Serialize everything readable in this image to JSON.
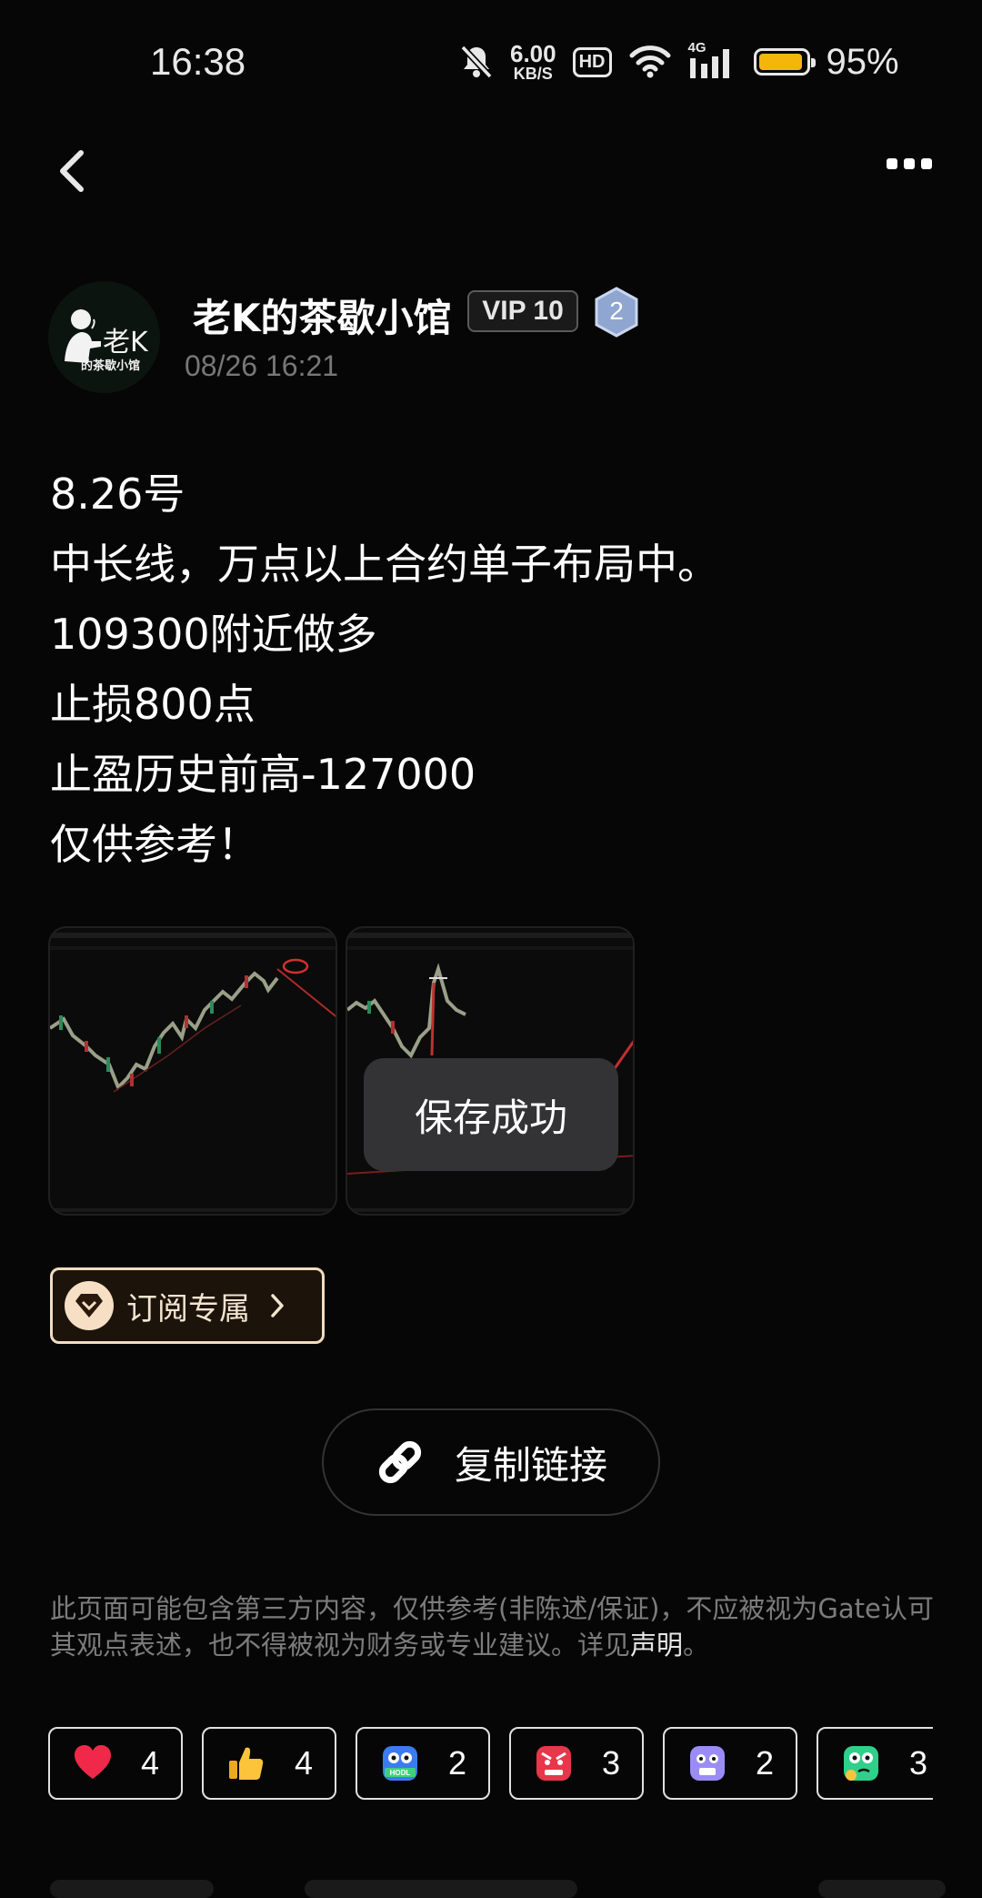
{
  "status_bar": {
    "time": "16:38",
    "net_speed_value": "6.00",
    "net_speed_unit": "KB/S",
    "hd": "HD",
    "signal_type": "4G",
    "battery_pct": "95%",
    "battery_level": 0.95,
    "battery_color": "#f5b60b"
  },
  "nav": {
    "back_icon": "chevron-left-icon",
    "more_icon": "more-dots-icon"
  },
  "author": {
    "name": "老K的茶歇小馆",
    "vip": "VIP 10",
    "level": "2",
    "timestamp": "08/26 16:21",
    "avatar_text_large": "老K",
    "avatar_text_small": "的茶歇小馆"
  },
  "post": {
    "lines": [
      "8.26号",
      "中长线，万点以上合约单子布局中。",
      "109300附近做多",
      "止损800点",
      "止盈历史前高-127000",
      "仅供参考！"
    ]
  },
  "toast": "保存成功",
  "subscribe": {
    "label": "订阅专属",
    "accent": "#f1dcc0"
  },
  "copy_link": {
    "label": "复制链接",
    "icon": "link-icon"
  },
  "disclaimer": {
    "text": "此页面可能包含第三方内容，仅供参考(非陈述/保证)，不应被视为Gate认可其观点表述，也不得被视为财务或专业建议。详见",
    "link": "声明",
    "end": "。"
  },
  "reactions": [
    {
      "icon": "heart-icon",
      "count": "4"
    },
    {
      "icon": "thumbs-up-icon",
      "count": "4"
    },
    {
      "icon": "hodl-emoji-icon",
      "count": "2"
    },
    {
      "icon": "angry-emoji-icon",
      "count": "3"
    },
    {
      "icon": "scared-emoji-icon",
      "count": "2"
    },
    {
      "icon": "thinking-emoji-icon",
      "count": "3"
    }
  ]
}
